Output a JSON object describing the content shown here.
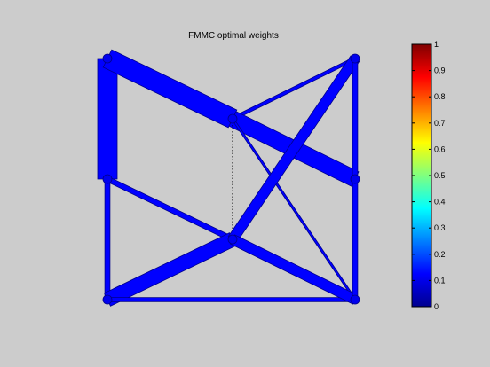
{
  "window": {
    "background": "#cccccc"
  },
  "chart_data": [
    {
      "type": "network",
      "title": "FMMC optimal weights",
      "grid": false,
      "legend": "none",
      "node_color": "#0000ee",
      "edge_color": "#0000ff",
      "edge_outline": "#00008b",
      "nodes": [
        {
          "id": 1,
          "x": 0,
          "y": 1.0
        },
        {
          "id": 2,
          "x": 0,
          "y": 0.5
        },
        {
          "id": 3,
          "x": 0,
          "y": 0.0
        },
        {
          "id": 4,
          "x": 1,
          "y": 0.75
        },
        {
          "id": 5,
          "x": 1,
          "y": 0.25
        },
        {
          "id": 6,
          "x": 2,
          "y": 1.0
        },
        {
          "id": 7,
          "x": 2,
          "y": 0.5
        },
        {
          "id": 8,
          "x": 2,
          "y": 0.0
        }
      ],
      "edges": [
        {
          "from": 1,
          "to": 2,
          "weight": 0.115
        },
        {
          "from": 1,
          "to": 4,
          "weight": 0.115
        },
        {
          "from": 2,
          "to": 3,
          "weight": 0.03
        },
        {
          "from": 2,
          "to": 5,
          "weight": 0.03
        },
        {
          "from": 3,
          "to": 5,
          "weight": 0.085
        },
        {
          "from": 3,
          "to": 8,
          "weight": 0.025
        },
        {
          "from": 4,
          "to": 6,
          "weight": 0.02
        },
        {
          "from": 4,
          "to": 7,
          "weight": 0.095
        },
        {
          "from": 4,
          "to": 8,
          "weight": 0.01
        },
        {
          "from": 4,
          "to": 5,
          "weight": 0.0,
          "style": "dotted"
        },
        {
          "from": 5,
          "to": 6,
          "weight": 0.06
        },
        {
          "from": 5,
          "to": 8,
          "weight": 0.06
        },
        {
          "from": 6,
          "to": 7,
          "weight": 0.03
        },
        {
          "from": 7,
          "to": 8,
          "weight": 0.03
        }
      ]
    },
    {
      "type": "colorbar",
      "colormap": "jet",
      "ylim": [
        0,
        1
      ],
      "ticks": [
        0,
        0.1,
        0.2,
        0.3,
        0.4,
        0.5,
        0.6,
        0.7,
        0.8,
        0.9,
        1
      ],
      "tick_labels": [
        "0",
        "0.1",
        "0.2",
        "0.3",
        "0.4",
        "0.5",
        "0.6",
        "0.7",
        "0.8",
        "0.9",
        "1"
      ]
    }
  ]
}
